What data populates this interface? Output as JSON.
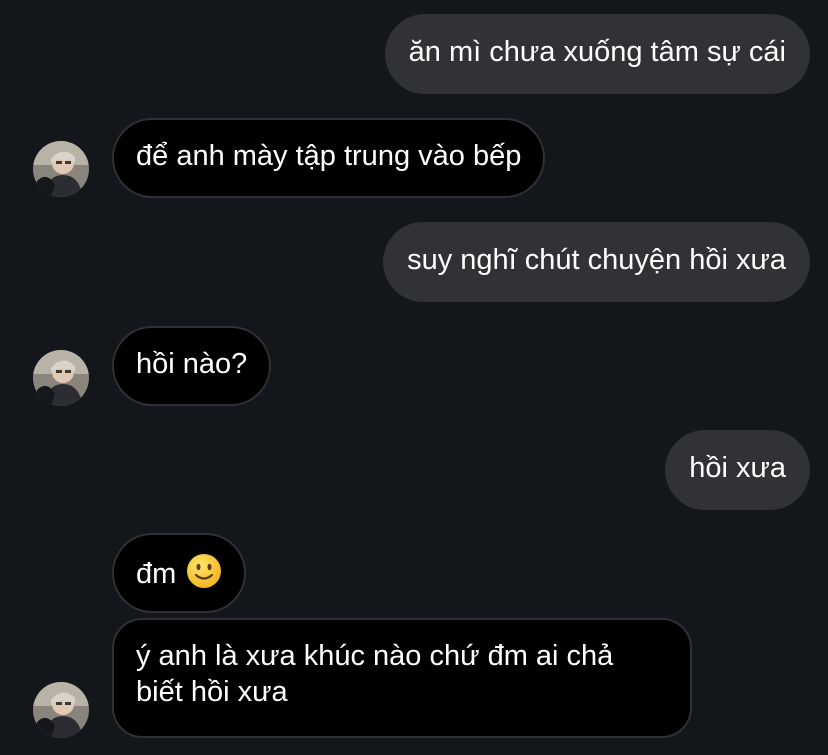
{
  "conversation": {
    "messages": [
      {
        "sender": "me",
        "text": "ăn mì chưa xuống tâm sự cái"
      },
      {
        "sender": "them",
        "text": "để anh mày tập trung vào bếp"
      },
      {
        "sender": "me",
        "text": "suy nghĩ chút chuyện hồi xưa"
      },
      {
        "sender": "them",
        "text": "hồi nào?"
      },
      {
        "sender": "me",
        "text": "hồi xưa"
      },
      {
        "sender": "them",
        "text": "đm",
        "emoji": "slightly-smiling-face-icon"
      },
      {
        "sender": "them",
        "text": "ý anh là xưa khúc nào chứ đm ai chả biết hồi xưa"
      }
    ]
  },
  "colors": {
    "background": "#13161b",
    "sent_bubble": "#303236",
    "received_bubble": "#000000",
    "received_border": "#2e3136",
    "text": "#ffffff"
  }
}
